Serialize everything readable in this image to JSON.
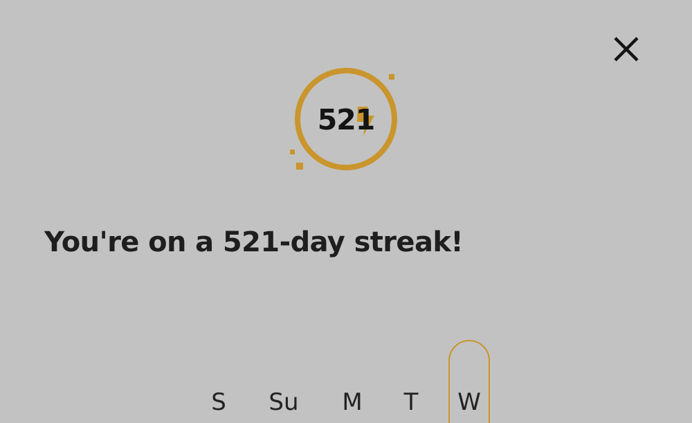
{
  "colors": {
    "background": "#c2c2c2",
    "accent": "#c9952c",
    "text": "#1e1e1e"
  },
  "close": {
    "icon": "close-icon"
  },
  "streak_badge": {
    "count": "521",
    "icon": "lightning-bolt-icon"
  },
  "headline": "You're on a 521-day streak!",
  "week": {
    "days": [
      "S",
      "Su",
      "M",
      "T",
      "W"
    ],
    "current_day": "W"
  }
}
